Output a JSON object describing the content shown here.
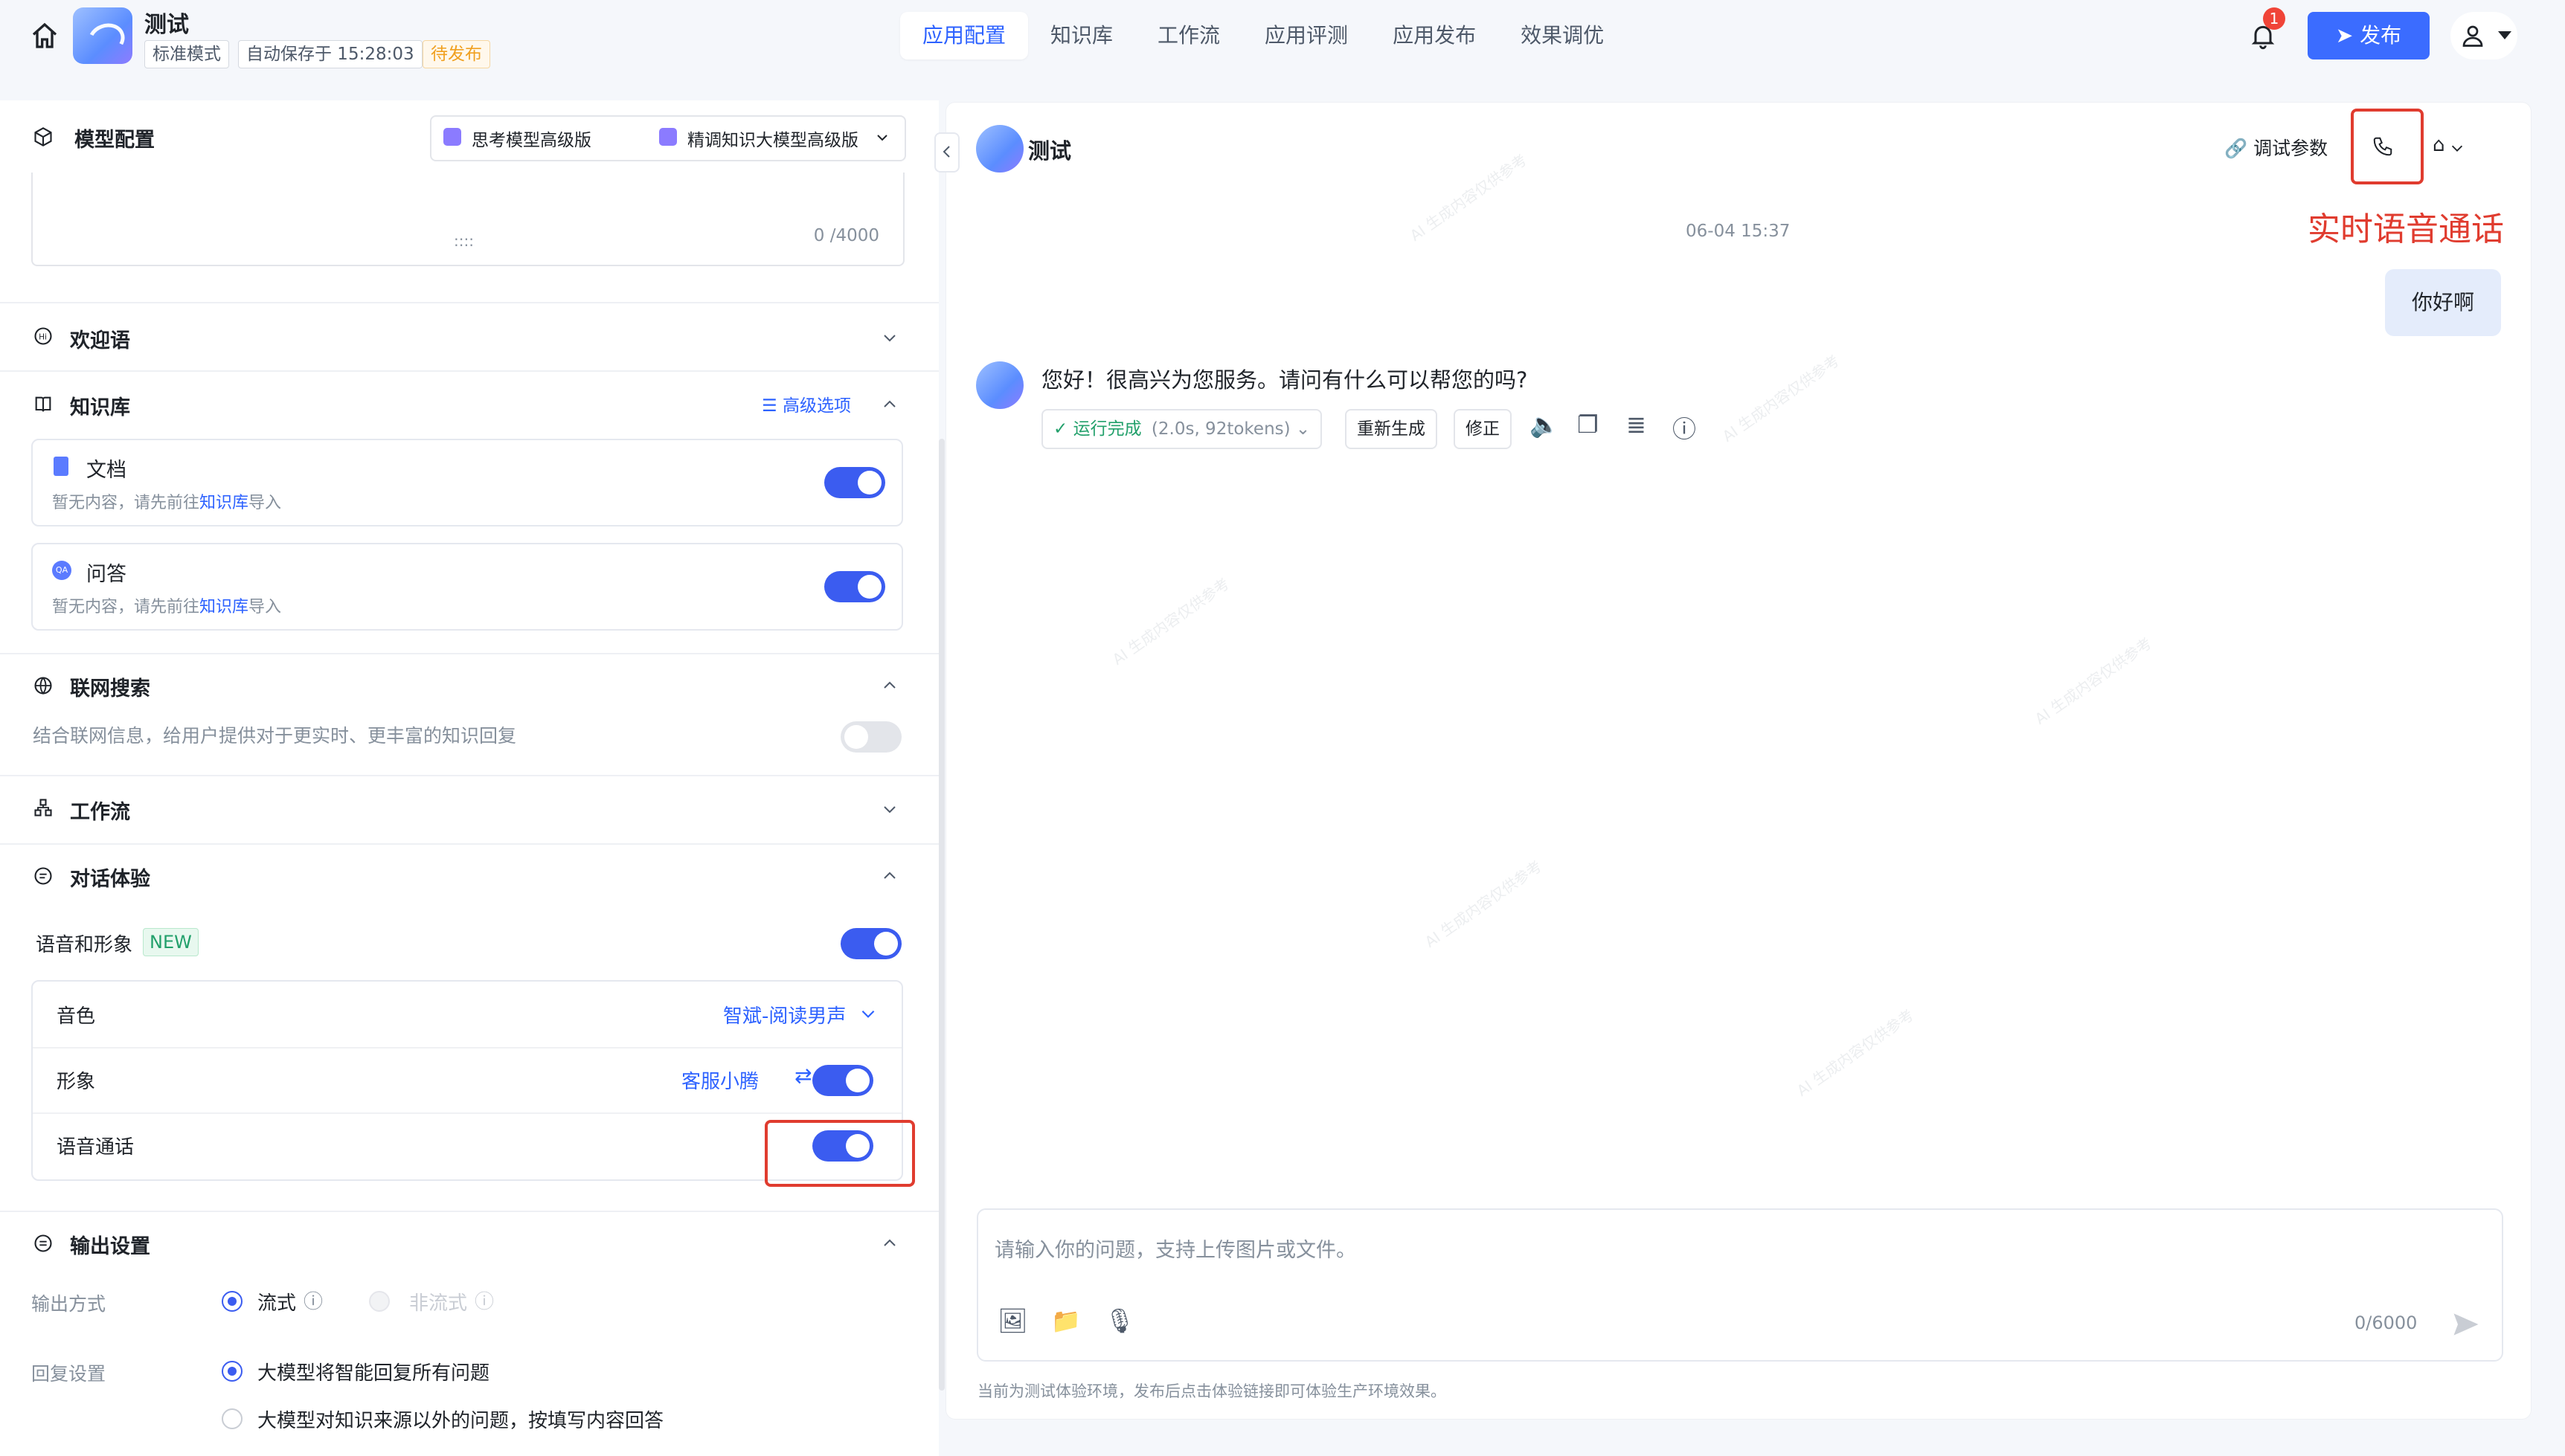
{
  "header": {
    "app_name": "测试",
    "mode_tag": "标准模式",
    "autosave": "自动保存于 15:28:03",
    "status": "待发布",
    "nav_tabs": [
      "应用配置",
      "知识库",
      "工作流",
      "应用评测",
      "应用发布",
      "效果调优"
    ],
    "notification_count": "1",
    "publish_label": "发布"
  },
  "left": {
    "model_config": {
      "title": "模型配置",
      "model_a": "思考模型高级版",
      "model_b": "精调知识大模型高级版",
      "prompt_counter": "0 /4000",
      "drag_handle": "::::"
    },
    "welcome": {
      "title": "欢迎语"
    },
    "knowledge": {
      "title": "知识库",
      "advanced": "高级选项",
      "items": [
        {
          "name": "文档",
          "hint_prefix": "暂无内容，请先前往",
          "hint_link": "知识库",
          "hint_suffix": "导入",
          "enabled": true
        },
        {
          "name": "问答",
          "hint_prefix": "暂无内容，请先前往",
          "hint_link": "知识库",
          "hint_suffix": "导入",
          "enabled": true
        }
      ]
    },
    "web_search": {
      "title": "联网搜索",
      "desc": "结合联网信息，给用户提供对于更实时、更丰富的知识回复",
      "enabled": false
    },
    "workflow": {
      "title": "工作流"
    },
    "dialog": {
      "title": "对话体验",
      "voice_label": "语音和形象",
      "new_badge": "NEW",
      "voice_enabled": true,
      "rows": [
        {
          "label": "音色",
          "value": "智斌-阅读男声"
        },
        {
          "label": "形象",
          "value": "客服小腾"
        },
        {
          "label": "语音通话"
        }
      ]
    },
    "output": {
      "title": "输出设置",
      "mode_label": "输出方式",
      "stream": "流式",
      "non_stream": "非流式",
      "reply_label": "回复设置",
      "reply_opt1": "大模型将智能回复所有问题",
      "reply_opt2": "大模型对知识来源以外的问题，按填写内容回答"
    }
  },
  "chat": {
    "title": "测试",
    "debug_params": "调试参数",
    "annotation": "实时语音通话",
    "timestamp": "06-04 15:37",
    "user_message": "你好啊",
    "bot_message": "您好！很高兴为您服务。请问有什么可以帮您的吗?",
    "run_status": "运行完成",
    "run_meta": "(2.0s, 92tokens)",
    "regenerate": "重新生成",
    "fix": "修正",
    "input_placeholder": "请输入你的问题，支持上传图片或文件。",
    "input_counter": "0/6000",
    "footer_note": "当前为测试体验环境，发布后点击体验链接即可体验生产环境效果。"
  },
  "colors": {
    "accent": "#3b5cf0",
    "annotation": "#e03c2f",
    "draft": "#f0a020"
  }
}
